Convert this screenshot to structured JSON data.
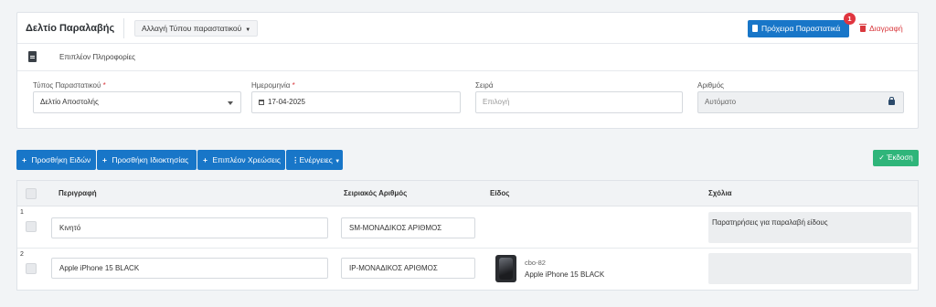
{
  "header": {
    "title": "Δελτίο Παραλαβής",
    "type_change_label": "Αλλαγή Τύπου παραστατικού",
    "drafts_label": "Πρόχειρα Παραστατικά",
    "drafts_badge": "1",
    "delete_label": "Διαγραφή"
  },
  "extra_info": {
    "label": "Επιπλέον Πληροφορίες"
  },
  "form": {
    "doc_type": {
      "label": "Τύπος Παραστατικού",
      "required": "*",
      "value": "Δελτίο Αποστολής"
    },
    "date": {
      "label": "Ημερομηνία",
      "required": "*",
      "value": "17-04-2025"
    },
    "series": {
      "label": "Σειρά",
      "placeholder": "Επιλογή"
    },
    "number": {
      "label": "Αριθμός",
      "value": "Αυτόματο"
    }
  },
  "actions": {
    "add_items": "Προσθήκη Ειδών",
    "add_property": "Προσθήκη Ιδιοκτησίας",
    "extra_charges": "Επιπλέον Χρεώσεις",
    "actions_menu": "Ενέργειες",
    "issue": "Έκδοση"
  },
  "table": {
    "columns": [
      "Περιγραφή",
      "Σειριακός Αριθμός",
      "Είδος",
      "Σχόλια"
    ],
    "rows": [
      {
        "num": "1",
        "description": "Κινητό",
        "serial": "SM-ΜΟΝΑΔΙΚΟΣ ΑΡΙΘΜΟΣ",
        "item_code": "",
        "item_name": "",
        "comment": "Παρατηρήσεις για παραλαβή είδους"
      },
      {
        "num": "2",
        "description": "Apple iPhone 15 BLACK",
        "serial": "IP-ΜΟΝΑΔΙΚΟΣ ΑΡΙΘΜΟΣ",
        "item_code": "cbo-82",
        "item_name": "Apple iPhone 15 BLACK",
        "comment": ""
      }
    ]
  },
  "colors": {
    "primary": "#1876c8",
    "success": "#2fb57a",
    "danger": "#d9383d"
  }
}
